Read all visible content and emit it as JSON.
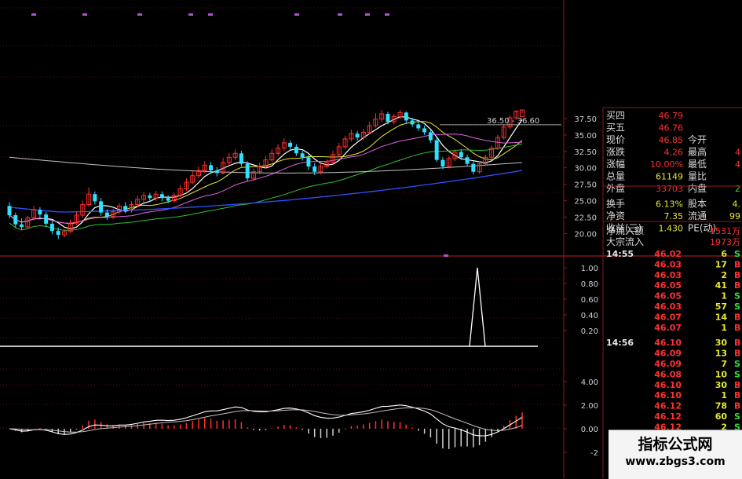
{
  "price_axis": {
    "labels": [
      "37.50",
      "35.00",
      "32.50",
      "30.00",
      "27.50",
      "25.00",
      "22.50",
      "20.00"
    ],
    "values": [
      37.5,
      35,
      32.5,
      30,
      27.5,
      25,
      22.5,
      20
    ],
    "max": 38.8,
    "min": 18.5
  },
  "price_marker": {
    "text": "36.50 - 36.60",
    "value": 36.55
  },
  "vol_axis": {
    "labels": [
      "1.00",
      "0.80",
      "0.60",
      "0.40",
      "0.20"
    ],
    "values": [
      1.0,
      0.8,
      0.6,
      0.4,
      0.2
    ]
  },
  "macd_axis": {
    "labels": [
      "4.00",
      "2.00",
      "0.00",
      "-2"
    ],
    "values": [
      4,
      2,
      0,
      -2
    ]
  },
  "quote_panel": {
    "rows": [
      {
        "label": "买四",
        "value": "46.79",
        "label2": "",
        "value2": "",
        "color": "#ff3030",
        "color2": "#ff3030"
      },
      {
        "label": "买五",
        "value": "46.76",
        "label2": "",
        "value2": "",
        "color": "#ff3030",
        "color2": "#ff3030"
      },
      {
        "label": "现价",
        "value": "46.85",
        "label2": "今开",
        "value2": "",
        "color": "#ff3030",
        "color2": "#ff3030"
      },
      {
        "label": "涨跌",
        "value": "4.26",
        "label2": "最高",
        "value2": "4",
        "color": "#ff3030",
        "color2": "#ff3030"
      },
      {
        "label": "涨幅",
        "value": "10.00%",
        "label2": "最低",
        "value2": "4",
        "color": "#ff3030",
        "color2": "#ff3030"
      },
      {
        "label": "总量",
        "value": "61149",
        "label2": "量比",
        "value2": "",
        "color": "#e8e830",
        "color2": "#e8e830"
      },
      {
        "label": "外盘",
        "value": "33703",
        "label2": "内盘",
        "value2": "2",
        "color": "#ff3030",
        "color2": "#30e030"
      },
      {
        "label": "换手",
        "value": "6.13%",
        "label2": "股本",
        "value2": "4.",
        "color": "#e8e830",
        "color2": "#e8e830"
      },
      {
        "label": "净资",
        "value": "7.35",
        "label2": "流通",
        "value2": "99",
        "color": "#e8e830",
        "color2": "#e8e830"
      },
      {
        "label": "收益(三)",
        "value": "1.430",
        "label2": "PE(动)",
        "value2": "",
        "color": "#e8e830",
        "color2": "#e8e830"
      }
    ],
    "flow": [
      {
        "label": "净流入额",
        "value": "1531万"
      },
      {
        "label": "大宗流入",
        "value": "1973万"
      }
    ]
  },
  "ticks": [
    {
      "time": "14:55",
      "price": "46.02",
      "vol": "6",
      "side": "S"
    },
    {
      "time": "",
      "price": "46.03",
      "vol": "17",
      "side": "B"
    },
    {
      "time": "",
      "price": "46.03",
      "vol": "2",
      "side": "B"
    },
    {
      "time": "",
      "price": "46.05",
      "vol": "41",
      "side": "B"
    },
    {
      "time": "",
      "price": "46.05",
      "vol": "1",
      "side": "S"
    },
    {
      "time": "",
      "price": "46.03",
      "vol": "57",
      "side": "S"
    },
    {
      "time": "",
      "price": "46.07",
      "vol": "14",
      "side": "B"
    },
    {
      "time": "",
      "price": "46.07",
      "vol": "1",
      "side": "B"
    },
    {
      "time": "14:56",
      "price": "46.10",
      "vol": "30",
      "side": "B"
    },
    {
      "time": "",
      "price": "46.09",
      "vol": "13",
      "side": "B"
    },
    {
      "time": "",
      "price": "46.09",
      "vol": "7",
      "side": "S"
    },
    {
      "time": "",
      "price": "46.08",
      "vol": "10",
      "side": "S"
    },
    {
      "time": "",
      "price": "46.10",
      "vol": "30",
      "side": "B"
    },
    {
      "time": "",
      "price": "46.10",
      "vol": "1",
      "side": "B"
    },
    {
      "time": "",
      "price": "46.12",
      "vol": "78",
      "side": "B"
    },
    {
      "time": "",
      "price": "46.12",
      "vol": "60",
      "side": "S"
    },
    {
      "time": "",
      "price": "46.12",
      "vol": "2",
      "side": "S"
    }
  ],
  "watermark": {
    "title": "指标公式网",
    "url": "www.zbgs3.com"
  },
  "colors": {
    "up": "#ff3030",
    "down": "#30e0ff",
    "grid": "#8b1a1a",
    "ma5": "#ffffff",
    "ma10": "#e8e830",
    "ma20": "#e060e0",
    "ma60": "#30c030",
    "ma120": "#3050ff",
    "ma250": "#c0c0c0"
  },
  "chart_data": {
    "type": "candlestick",
    "candles": [
      [
        24.2,
        22.8,
        24.8,
        22.3
      ],
      [
        22.8,
        21.4,
        23.2,
        20.9
      ],
      [
        21.4,
        21.0,
        22.3,
        20.6
      ],
      [
        21.0,
        22.4,
        22.7,
        20.7
      ],
      [
        22.4,
        23.6,
        24.2,
        22.0
      ],
      [
        23.6,
        22.9,
        24.0,
        22.4
      ],
      [
        22.9,
        21.5,
        23.3,
        21.0
      ],
      [
        21.5,
        20.4,
        21.9,
        19.9
      ],
      [
        20.4,
        19.8,
        20.9,
        19.2
      ],
      [
        19.8,
        20.3,
        20.7,
        19.4
      ],
      [
        20.3,
        21.6,
        22.1,
        20.1
      ],
      [
        21.6,
        22.8,
        23.3,
        21.3
      ],
      [
        22.8,
        24.4,
        25.0,
        22.4
      ],
      [
        24.4,
        26.0,
        27.0,
        24.1
      ],
      [
        26.0,
        24.9,
        26.4,
        24.4
      ],
      [
        24.9,
        23.2,
        25.4,
        22.7
      ],
      [
        23.2,
        22.6,
        23.7,
        22.1
      ],
      [
        22.6,
        23.3,
        23.8,
        22.2
      ],
      [
        23.3,
        24.2,
        24.6,
        22.9
      ],
      [
        24.2,
        23.6,
        24.8,
        23.1
      ],
      [
        23.6,
        24.4,
        24.9,
        23.2
      ],
      [
        24.4,
        25.2,
        25.8,
        24.0
      ],
      [
        25.2,
        25.8,
        26.3,
        24.8
      ],
      [
        25.8,
        25.4,
        26.2,
        24.9
      ],
      [
        25.4,
        26.0,
        26.5,
        25.0
      ],
      [
        26.0,
        25.4,
        26.4,
        24.9
      ],
      [
        25.4,
        25.0,
        25.8,
        24.6
      ],
      [
        25.0,
        25.8,
        26.2,
        24.7
      ],
      [
        25.8,
        26.8,
        27.4,
        25.5
      ],
      [
        26.8,
        27.8,
        28.4,
        26.5
      ],
      [
        27.8,
        28.8,
        29.5,
        27.5
      ],
      [
        28.8,
        29.6,
        30.2,
        28.4
      ],
      [
        29.6,
        30.4,
        31.0,
        29.2
      ],
      [
        30.4,
        29.6,
        30.9,
        29.1
      ],
      [
        29.6,
        29.2,
        30.1,
        28.7
      ],
      [
        29.2,
        30.8,
        31.5,
        29.0
      ],
      [
        30.8,
        31.6,
        32.2,
        30.4
      ],
      [
        31.6,
        32.2,
        32.8,
        31.2
      ],
      [
        32.2,
        30.6,
        32.6,
        30.2
      ],
      [
        30.6,
        28.4,
        31.0,
        27.9
      ],
      [
        28.4,
        29.4,
        29.9,
        28.0
      ],
      [
        29.4,
        30.2,
        30.8,
        29.0
      ],
      [
        30.2,
        31.2,
        31.8,
        29.9
      ],
      [
        31.2,
        32.2,
        32.8,
        30.9
      ],
      [
        32.2,
        33.0,
        33.6,
        31.8
      ],
      [
        33.0,
        33.8,
        34.5,
        32.6
      ],
      [
        33.8,
        33.2,
        34.2,
        32.7
      ],
      [
        33.2,
        32.2,
        33.6,
        31.8
      ],
      [
        32.2,
        31.6,
        32.6,
        31.1
      ],
      [
        31.6,
        30.2,
        32.0,
        29.7
      ],
      [
        30.2,
        29.4,
        30.7,
        28.9
      ],
      [
        29.4,
        30.2,
        30.6,
        29.0
      ],
      [
        30.2,
        30.8,
        31.3,
        29.9
      ],
      [
        30.8,
        32.0,
        32.6,
        30.5
      ],
      [
        32.0,
        33.2,
        33.8,
        31.7
      ],
      [
        33.2,
        34.4,
        34.9,
        32.9
      ],
      [
        34.4,
        35.2,
        35.8,
        34.0
      ],
      [
        35.2,
        34.6,
        35.6,
        34.1
      ],
      [
        34.6,
        35.4,
        35.9,
        34.2
      ],
      [
        35.4,
        36.4,
        37.0,
        35.1
      ],
      [
        36.4,
        37.4,
        38.3,
        36.1
      ],
      [
        37.4,
        38.2,
        38.8,
        37.0
      ],
      [
        38.2,
        37.0,
        38.5,
        36.6
      ],
      [
        37.0,
        37.8,
        38.2,
        36.6
      ],
      [
        37.8,
        38.4,
        38.8,
        37.4
      ],
      [
        38.4,
        37.2,
        38.6,
        36.8
      ],
      [
        37.2,
        36.6,
        37.6,
        36.2
      ],
      [
        36.6,
        36.0,
        37.0,
        35.6
      ],
      [
        36.0,
        35.4,
        36.4,
        35.0
      ],
      [
        35.4,
        34.2,
        35.8,
        33.8
      ],
      [
        34.2,
        31.2,
        34.6,
        30.9
      ],
      [
        31.2,
        30.2,
        31.6,
        29.8
      ],
      [
        30.2,
        31.4,
        31.8,
        29.9
      ],
      [
        31.4,
        32.4,
        32.8,
        31.0
      ],
      [
        32.4,
        31.6,
        32.8,
        31.2
      ],
      [
        31.6,
        30.6,
        32.0,
        30.2
      ],
      [
        30.6,
        29.4,
        31.0,
        29.0
      ],
      [
        29.4,
        30.6,
        31.0,
        29.1
      ],
      [
        30.6,
        31.6,
        32.0,
        30.3
      ],
      [
        31.6,
        33.0,
        33.4,
        31.3
      ],
      [
        33.0,
        34.6,
        35.0,
        32.7
      ],
      [
        34.6,
        36.2,
        36.6,
        34.3
      ],
      [
        36.2,
        37.6,
        38.0,
        35.9
      ],
      [
        37.6,
        38.6,
        39.2,
        37.3
      ],
      [
        38.6,
        39.6,
        40.2,
        38.3
      ]
    ]
  }
}
